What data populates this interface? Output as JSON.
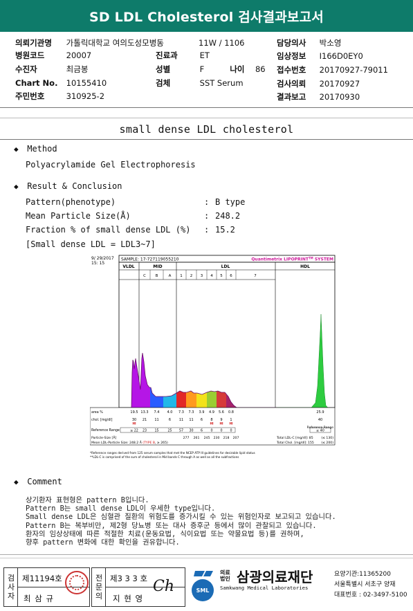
{
  "title": "SD LDL Cholesterol 검사결과보고서",
  "header": {
    "institution_label": "의뢰기관명",
    "institution": "가톨릭대학교 여의도성모병동",
    "ward": "11W / 1106",
    "hospital_code_label": "병원코드",
    "hospital_code": "20007",
    "dept_label": "진료과",
    "dept": "ET",
    "patient_label": "수진자",
    "patient": "최금봉",
    "sex_label": "성별",
    "sex": "F",
    "age_label": "나이",
    "age": "86",
    "chart_label": "Chart No.",
    "chart_no": "10155410",
    "specimen_label": "검체",
    "specimen": "SST Serum",
    "rrn_label": "주민번호",
    "rrn": "310925-2",
    "doctor_label": "담당의사",
    "doctor": "박소영",
    "clinical_label": "임상정보",
    "clinical": "I166D0EY0",
    "receipt_label": "접수번호",
    "receipt": "20170927-79011",
    "request_label": "검사의뢰",
    "request": "20170927",
    "report_label": "결과보고",
    "report": "20170930"
  },
  "section_title": "small dense LDL cholesterol",
  "method": {
    "heading": "Method",
    "text": "Polyacrylamide Gel Electrophoresis"
  },
  "result": {
    "heading": "Result & Conclusion",
    "rows": [
      {
        "label": "Pattern(phenotype)",
        "colon": ":",
        "value": "B type"
      },
      {
        "label": "Mean Particle Size(Å)",
        "colon": ":",
        "value": "248.2"
      },
      {
        "label": "Fraction % of small dense LDL (%)",
        "colon": ":",
        "value": "15.2"
      }
    ],
    "note": "[Small dense LDL = LDL3~7]"
  },
  "chart_data": {
    "type": "area",
    "date": "9/ 29/2017",
    "time": "15: 15",
    "sample": "SAMPLE:  17-727119055210",
    "brand": "Quantimetrix LIPOPRINT",
    "brand_tm": "TM",
    "brand_suffix": " SYSTEM",
    "group_labels": [
      "VLDL",
      "MID",
      "LDL",
      "HDL"
    ],
    "band_labels": [
      "C",
      "B",
      "A",
      "1",
      "2",
      "3",
      "4",
      "5",
      "6",
      "7"
    ],
    "band_colors": [
      "#b516e6",
      "#2a5cff",
      "#22b8e8",
      "#e22727",
      "#ff9a1e",
      "#f3e21a",
      "#9acd32",
      "#d63a3a",
      "#a6236a",
      "#2ecc40"
    ],
    "row_area_label": "area %",
    "area": [
      "19.5",
      "13.3",
      "7.4",
      "4.0",
      "7.3",
      "7.3",
      "3.9",
      "4.9",
      "5.6",
      "0.8",
      "25.9"
    ],
    "row_chol_label": "chol. [mg/dl]",
    "chol": [
      "30",
      "21",
      "11",
      "6",
      "11",
      "11",
      "6",
      "8",
      "9",
      "1",
      "40"
    ],
    "chol_flag": "HI",
    "row_ref_label": "Reference Range",
    "ref": [
      "≤ 22",
      "23",
      "15",
      "25",
      "57",
      "30",
      "6",
      "0",
      "0",
      "0",
      "≥ 40"
    ],
    "ref_right_label": "Reference Range",
    "particle_size_label": "Particle-Size [Å]",
    "particle_sizes": [
      "277",
      "261",
      "245",
      "230",
      "218",
      "207"
    ],
    "total_ldl_label": "Total LDL-C [mg/dl]: 85",
    "total_ldl_ref": "(≤ 130)",
    "total_chol_label": "Total Chol. [mg/dl]: 155",
    "total_chol_ref": "(≤ 200)",
    "mean_size_label": "Mean LDL-Particle Size:  248.2 Å",
    "type_label": "(TYPE B",
    "type_ref": "≥ 265)",
    "footnote1": "*Reference ranges derived from 125 serum samples that met the NCEP ATP III guidelines for desirable lipid status",
    "footnote2": "**LDL-C is comprised of the sum of cholesterol in Mid bands C through A as well as all the subfractions"
  },
  "comment": {
    "heading": "Comment",
    "lines": [
      "상기환자 표현형은 pattern B입니다.",
      "Pattern B는 small dense LDL이 우세한 type입니다.",
      "Small dense LDL은 심혈관 질환의 위험도를 증가시킬 수 있는 위험인자로 보고되고 있습니다.",
      "Pattern B는 복부비만, 제2형 당뇨병 또는 대사 증후군 등에서 많이 관찰되고 있습니다.",
      "환자의 임상상태에 따른 적절한 치료(운동요법, 식이요법 또는 약물요법 등)를 권하며,",
      "향후 pattern 변화에 대한 확인을 권유합니다."
    ]
  },
  "footer": {
    "tester_label": "검사자",
    "tester_no": "제11194호",
    "tester_name": "최 삼 규",
    "specialist_label": "전문의",
    "specialist_no": "제3 3 3 호",
    "specialist_name": "지 현 영",
    "signature": "Ch",
    "foundation_prefix1": "의료",
    "foundation_prefix2": "법인",
    "foundation": "삼광의료재단",
    "foundation_en": "Samkwang Medical Laboratories",
    "logo_text": "SML",
    "org_code": "요양기관:11365200",
    "address": "서울특별시 서초구 양재",
    "phone": "대표번호 : 02-3497-5100"
  }
}
